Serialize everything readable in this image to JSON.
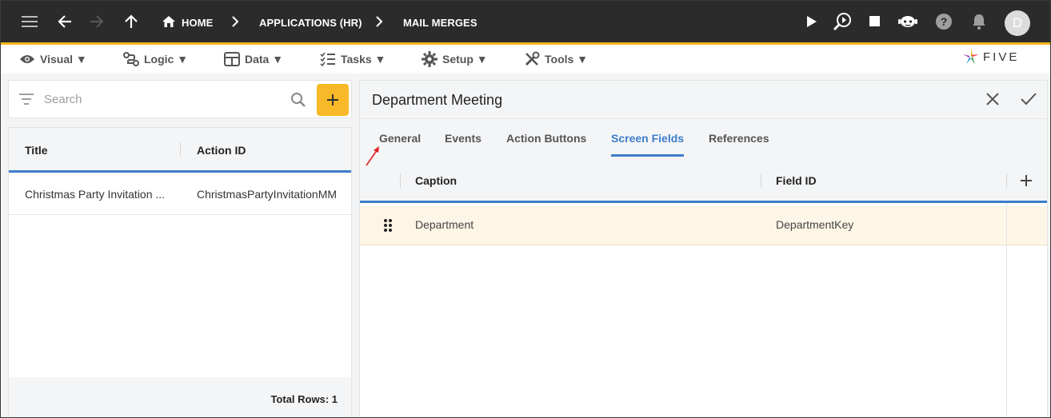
{
  "topbar": {
    "breadcrumbs": [
      "HOME",
      "APPLICATIONS (HR)",
      "MAIL MERGES"
    ],
    "avatar_initial": "D",
    "icons": [
      "menu-icon",
      "back-arrow-icon",
      "forward-arrow-icon",
      "up-arrow-icon",
      "home-icon",
      "play-icon",
      "debug-search-icon",
      "stop-icon",
      "chat-bot-icon",
      "help-icon",
      "bell-icon"
    ]
  },
  "menubar": {
    "items": [
      {
        "label": "Visual ▼",
        "icon": "eye-icon"
      },
      {
        "label": "Logic ▼",
        "icon": "flow-icon"
      },
      {
        "label": "Data ▼",
        "icon": "table-icon"
      },
      {
        "label": "Tasks ▼",
        "icon": "checklist-icon"
      },
      {
        "label": "Setup ▼",
        "icon": "gear-icon"
      },
      {
        "label": "Tools ▼",
        "icon": "wrench-icon"
      }
    ],
    "logo_text": "FIVE"
  },
  "search": {
    "placeholder": "Search"
  },
  "list": {
    "columns": [
      "Title",
      "Action ID"
    ],
    "rows": [
      {
        "title": "Christmas Party Invitation ...",
        "action_id": "ChristmasPartyInvitationMM"
      }
    ],
    "total": "Total Rows: 1"
  },
  "form": {
    "title": "Department Meeting",
    "tabs": [
      "General",
      "Events",
      "Action Buttons",
      "Screen Fields",
      "References"
    ],
    "active_tab": "Screen Fields",
    "grid": {
      "columns": [
        "Caption",
        "Field ID"
      ],
      "rows": [
        {
          "caption": "Department",
          "field_id": "DepartmentKey"
        }
      ]
    }
  },
  "colors": {
    "accent": "#f5b81c",
    "tab_active": "#3d7dca",
    "row_highlight": "#fdf6e6",
    "topbar": "#2b2b2b"
  }
}
